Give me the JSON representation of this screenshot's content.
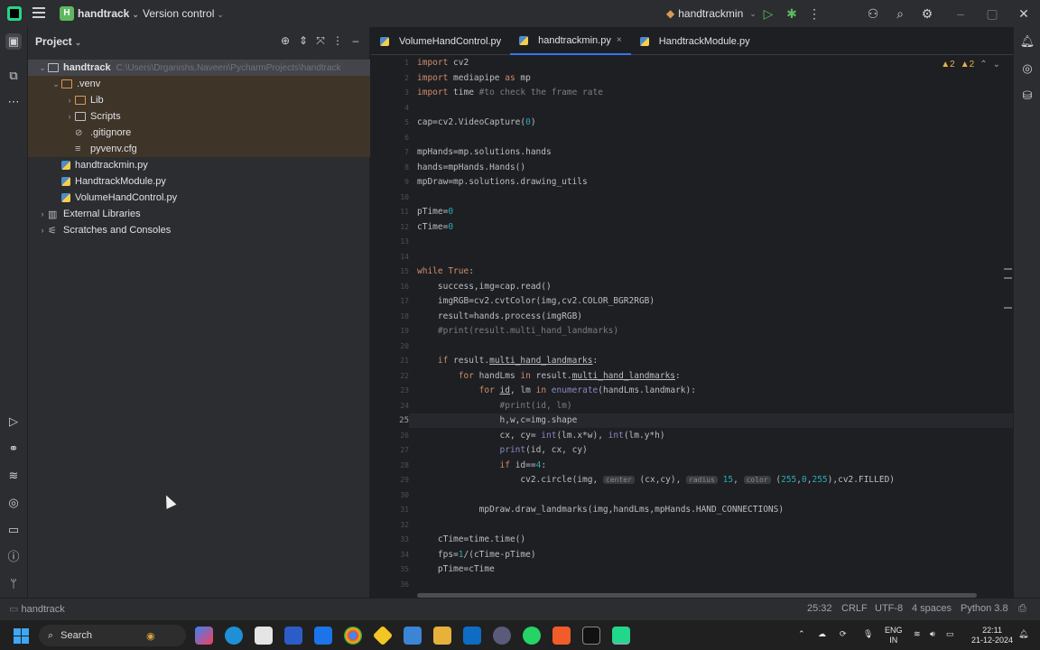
{
  "titlebar": {
    "project_badge": "H",
    "project": "handtrack",
    "vcs": "Version control",
    "run_config": "handtrackmin"
  },
  "project_panel": {
    "title": "Project",
    "tree": [
      {
        "label": "handtrack",
        "extra": "C:\\Users\\Drganishs.Naveen\\PycharmProjects\\handtrack",
        "depth": 0,
        "twisty": "▾",
        "icon": "folder",
        "highlight": "sel",
        "bold": true
      },
      {
        "label": ".venv",
        "depth": 1,
        "twisty": "▾",
        "icon": "folder-orange",
        "highlight": "hl"
      },
      {
        "label": "Lib",
        "depth": 2,
        "twisty": "›",
        "icon": "folder-orange",
        "highlight": "hl"
      },
      {
        "label": "Scripts",
        "depth": 2,
        "twisty": "›",
        "icon": "folder",
        "highlight": "hl"
      },
      {
        "label": ".gitignore",
        "depth": 2,
        "twisty": "",
        "icon": "gitignore",
        "highlight": "hl"
      },
      {
        "label": "pyvenv.cfg",
        "depth": 2,
        "twisty": "",
        "icon": "cfg",
        "highlight": "hl"
      },
      {
        "label": "handtrackmin.py",
        "depth": 1,
        "twisty": "",
        "icon": "py",
        "highlight": ""
      },
      {
        "label": "HandtrackModule.py",
        "depth": 1,
        "twisty": "",
        "icon": "py",
        "highlight": ""
      },
      {
        "label": "VolumeHandControl.py",
        "depth": 1,
        "twisty": "",
        "icon": "py",
        "highlight": ""
      },
      {
        "label": "External Libraries",
        "depth": 0,
        "twisty": "›",
        "icon": "lib",
        "highlight": ""
      },
      {
        "label": "Scratches and Consoles",
        "depth": 0,
        "twisty": "›",
        "icon": "scratch",
        "highlight": ""
      }
    ]
  },
  "tabs": [
    {
      "label": "VolumeHandControl.py",
      "active": false
    },
    {
      "label": "handtrackmin.py",
      "active": true
    },
    {
      "label": "HandtrackModule.py",
      "active": false
    }
  ],
  "editor": {
    "warnings": "▲2",
    "weak_warnings": "▲2",
    "current_line": 25,
    "lines": [
      {
        "n": 1,
        "html": "<span class='kw'>import</span> cv2"
      },
      {
        "n": 2,
        "html": "<span class='kw'>import</span> mediapipe <span class='kw'>as</span> mp"
      },
      {
        "n": 3,
        "html": "<span class='kw'>import</span> time <span class='cm'>#to check the frame rate</span>"
      },
      {
        "n": 4,
        "html": ""
      },
      {
        "n": 5,
        "html": "cap=cv2.VideoCapture(<span class='num'>0</span>)"
      },
      {
        "n": 6,
        "html": ""
      },
      {
        "n": 7,
        "html": "mpHands=mp.solutions.hands"
      },
      {
        "n": 8,
        "html": "hands=mpHands.Hands()"
      },
      {
        "n": 9,
        "html": "mpDraw=mp.solutions.drawing_utils"
      },
      {
        "n": 10,
        "html": ""
      },
      {
        "n": 11,
        "html": "pTime=<span class='num'>0</span>"
      },
      {
        "n": 12,
        "html": "cTime=<span class='num'>0</span>"
      },
      {
        "n": 13,
        "html": ""
      },
      {
        "n": 14,
        "html": ""
      },
      {
        "n": 15,
        "html": "<span class='kw'>while True</span>:"
      },
      {
        "n": 16,
        "html": "    success,img=cap.read()"
      },
      {
        "n": 17,
        "html": "    imgRGB=cv2.cvtColor(img,cv2.COLOR_BGR2RGB)"
      },
      {
        "n": 18,
        "html": "    result=hands.process(imgRGB)"
      },
      {
        "n": 19,
        "html": "    <span class='cm'>#print(result.multi_hand_landmarks)</span>"
      },
      {
        "n": 20,
        "html": ""
      },
      {
        "n": 21,
        "html": "    <span class='kw'>if</span> result.<span class='ul'>multi_hand_landmarks</span>:"
      },
      {
        "n": 22,
        "html": "        <span class='kw'>for</span> handLms <span class='kw'>in</span> result.<span class='ul'>multi_hand_landmarks</span>:"
      },
      {
        "n": 23,
        "html": "            <span class='kw'>for</span> <span class='ul'>id</span>, lm <span class='kw'>in</span> <span class='bi'>enumerate</span>(handLms.landmark):"
      },
      {
        "n": 24,
        "html": "                <span class='cm'>#print(id, lm)</span>"
      },
      {
        "n": 25,
        "html": "                h,w,c=img.shape"
      },
      {
        "n": 26,
        "html": "                cx, cy= <span class='bi'>int</span>(lm.x*w), <span class='bi'>int</span>(lm.y*h)"
      },
      {
        "n": 27,
        "html": "                <span class='bi'>print</span>(id, cx, cy)"
      },
      {
        "n": 28,
        "html": "                <span class='kw'>if</span> id==<span class='num'>4</span>:"
      },
      {
        "n": 29,
        "html": "                    cv2.circle(img, <span class='hint'>center</span> (cx,cy), <span class='hint'>radius</span> <span class='num'>15</span>, <span class='hint'>color</span> (<span class='num'>255</span>,<span class='num'>0</span>,<span class='num'>255</span>),cv2.FILLED)"
      },
      {
        "n": 30,
        "html": ""
      },
      {
        "n": 31,
        "html": "            mpDraw.draw_landmarks(img,handLms,mpHands.HAND_CONNECTIONS)"
      },
      {
        "n": 32,
        "html": ""
      },
      {
        "n": 33,
        "html": "    cTime=time.time()"
      },
      {
        "n": 34,
        "html": "    fps=<span class='num'>1</span>/(cTime-pTime)"
      },
      {
        "n": 35,
        "html": "    pTime=cTime"
      },
      {
        "n": 36,
        "html": ""
      }
    ]
  },
  "statusbar": {
    "breadcrumb": "handtrack",
    "position": "25:32",
    "line_sep": "CRLF",
    "encoding": "UTF-8",
    "indent": "4 spaces",
    "interpreter": "Python 3.8"
  },
  "taskbar": {
    "search": "Search",
    "lang_top": "ENG",
    "lang_bottom": "IN",
    "time": "22:11",
    "date": "21-12-2024"
  }
}
